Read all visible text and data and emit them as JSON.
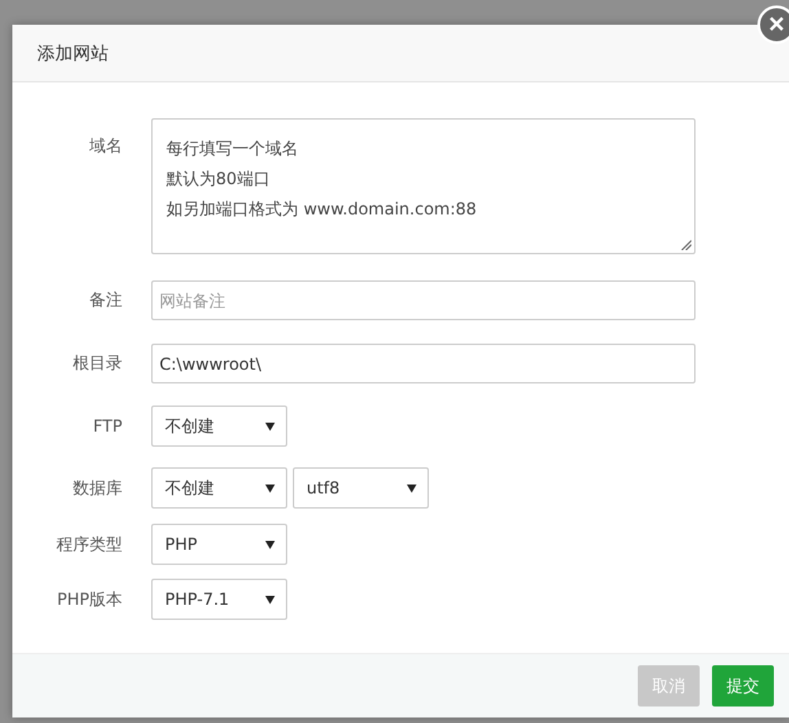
{
  "dialog": {
    "title": "添加网站",
    "close": "×"
  },
  "fields": [
    {
      "kind": "textarea",
      "label": "域名",
      "placeholder_lines": [
        "每行填写一个域名",
        "默认为80端口",
        "如另加端口格式为 www.domain.com:88"
      ]
    },
    {
      "kind": "input",
      "label": "备注",
      "placeholder": "网站备注"
    },
    {
      "kind": "input",
      "label": "根目录",
      "value": "C:\\wwwroot\\"
    },
    {
      "kind": "select",
      "label": "FTP",
      "selects": [
        "不创建"
      ]
    },
    {
      "kind": "select",
      "label": "数据库",
      "selects": [
        "不创建",
        "utf8"
      ]
    },
    {
      "kind": "select",
      "label": "程序类型",
      "selects": [
        "PHP"
      ]
    },
    {
      "kind": "select",
      "label": "PHP版本",
      "selects": [
        "PHP-7.1"
      ]
    }
  ],
  "buttons": [
    {
      "label": "取消",
      "kind": "cancel"
    },
    {
      "label": "提交",
      "kind": "submit"
    }
  ]
}
